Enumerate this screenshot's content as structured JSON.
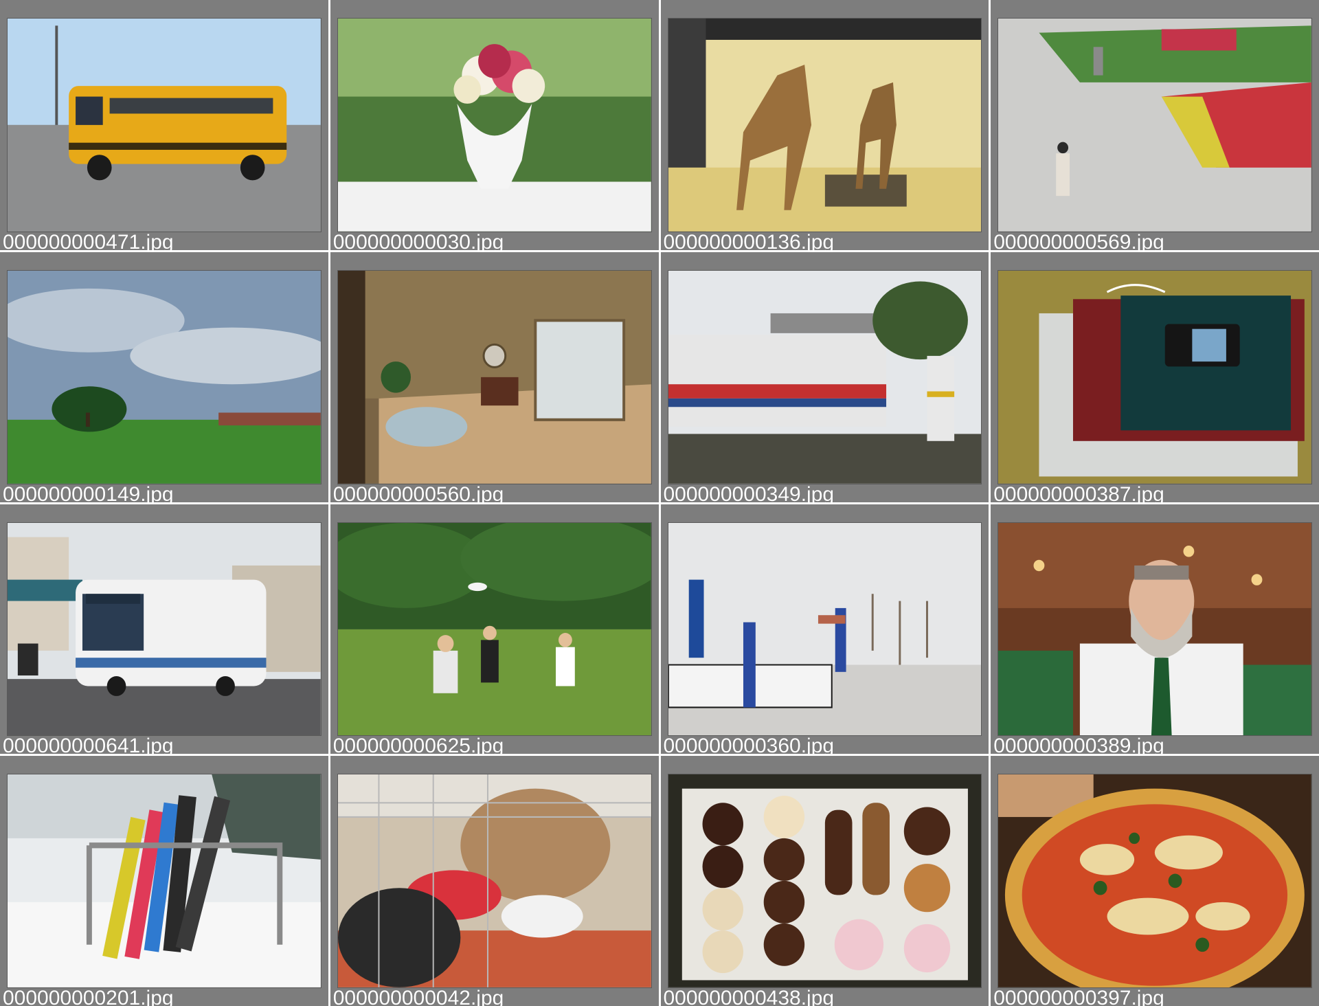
{
  "gallery": {
    "tiles": [
      {
        "filename": "000000000471.jpg",
        "subject": "yellow-school-bus"
      },
      {
        "filename": "000000000030.jpg",
        "subject": "flower-vase"
      },
      {
        "filename": "000000000136.jpg",
        "subject": "giraffes"
      },
      {
        "filename": "000000000569.jpg",
        "subject": "kite-plaza"
      },
      {
        "filename": "000000000149.jpg",
        "subject": "park-kites"
      },
      {
        "filename": "000000000560.jpg",
        "subject": "bathroom"
      },
      {
        "filename": "000000000349.jpg",
        "subject": "train"
      },
      {
        "filename": "000000000387.jpg",
        "subject": "laptop-phone"
      },
      {
        "filename": "000000000641.jpg",
        "subject": "city-bus"
      },
      {
        "filename": "000000000625.jpg",
        "subject": "frisbee-players"
      },
      {
        "filename": "000000000360.jpg",
        "subject": "snowboard-jump"
      },
      {
        "filename": "000000000389.jpg",
        "subject": "bearded-man"
      },
      {
        "filename": "000000000201.jpg",
        "subject": "snowboards-rack"
      },
      {
        "filename": "000000000042.jpg",
        "subject": "dog-shoes"
      },
      {
        "filename": "000000000438.jpg",
        "subject": "donuts-box"
      },
      {
        "filename": "000000000397.jpg",
        "subject": "pizza"
      }
    ]
  },
  "colors": {
    "tile_background": "#7d7d7d",
    "caption_text": "#ffffff",
    "grid_gap": "#ffffff"
  }
}
